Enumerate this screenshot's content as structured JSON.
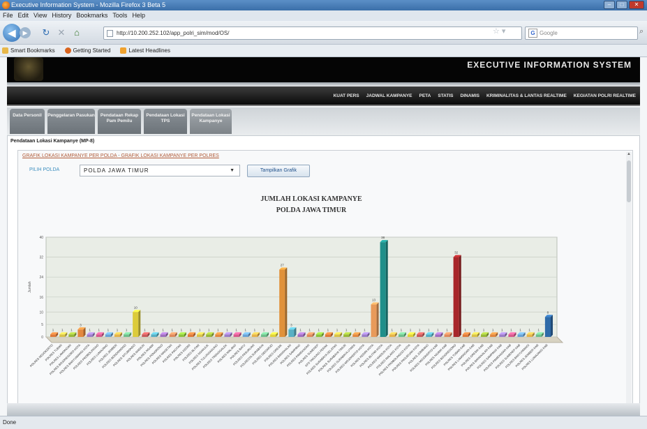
{
  "window": {
    "title": "Executive Information System - Mozilla Firefox 3 Beta 5"
  },
  "menu": [
    "File",
    "Edit",
    "View",
    "History",
    "Bookmarks",
    "Tools",
    "Help"
  ],
  "address": {
    "url": "http://10.200.252.102/app_polri_sim/mod/OS/"
  },
  "search": {
    "placeholder": "Google"
  },
  "bookmarks": [
    "Smart Bookmarks",
    "Getting Started",
    "Latest Headlines"
  ],
  "header": {
    "title": "EXECUTIVE INFORMATION SYSTEM"
  },
  "main_nav": [
    "KUAT PERS",
    "JADWAL KAMPANYE",
    "PETA",
    "STATIS",
    "DINAMIS",
    "KRIMINALITAS & LANTAS REALTIME",
    "KEGIATAN POLRI REALTIME"
  ],
  "tabs": [
    "Data Personil",
    "Penggelaran Pasukan",
    "Pendataan Rekap Pam Pemilu",
    "Pendataan Lokasi TPS",
    "Pendataan Lokasi Kampanye"
  ],
  "section": {
    "title": "Pendataan Lokasi Kampanye (MP-8)"
  },
  "links": {
    "per_polda": "GRAFIK LOKASI KAMPANYE PER POLDA",
    "per_polres": "GRAFIK LOKASI KAMPANYE PER POLRES",
    "separator": "-"
  },
  "filter": {
    "label": "PILIH POLDA",
    "selected": "POLDA JAWA TIMUR",
    "button": "Tampilkan Grafik"
  },
  "status": "Done",
  "chart_data": {
    "type": "bar",
    "title": "JUMLAH LOKASI KAMPANYE",
    "subtitle": "POLDA JAWA TIMUR",
    "ylabel": "Jumlah",
    "ylim": [
      0,
      40
    ],
    "yticks": [
      0,
      5,
      10,
      16,
      24,
      32,
      40
    ],
    "categories": [
      "POLRES MOJOKERTO",
      "POLRES TUBAN",
      "POLRES LAMONGAN",
      "POLRES BOJONEGORO KOTA",
      "POLRES BANYUWANGI KOTA",
      "POLRES PROBOLINGGO",
      "POLRES LUMAJANG",
      "POLRES JEMBER",
      "POLRES BONDOWOSO",
      "POLRES SITUBONDO",
      "POLRES MADIUN",
      "POLRES NGAWI",
      "POLRES PONOROGO",
      "POLRES MAGETAN",
      "POLRES PACITAN",
      "POLRES KEDIRI",
      "POLRES BLITAR",
      "POLRES NGANJUK",
      "POLRES TULUNGAGUNG",
      "POLRES TRENGGALEK",
      "POLRES MALANG",
      "POLRES BATU",
      "POLRES PASURUAN",
      "POLRESTA SURABAYA",
      "POLRES SIDOARJO",
      "POLRES GRESIK",
      "POLRES BANGKALAN",
      "POLRES SAMPANG",
      "POLRES PAMEKASAN",
      "POLRES SUMENEP",
      "KP3 TANJUNG PERAK",
      "POLRES SURABAYA SELATAN",
      "POLRES SURABAYA TIMUR",
      "POLRES SURABAYA UTARA",
      "POLRES MOJOKERTO KOTA",
      "POLRES KEDIRI KOTA",
      "POLRES BLITAR KOTA",
      "POLRES MADIUN KOTA",
      "POLRES MALANG KOTA",
      "POLRES PROBOLINGGO KOTA",
      "POLRES PASURUAN KOTA",
      "POLRES JOMBANG",
      "POLRES MOJOKERTO KAB",
      "POLRES NGAWI KAB",
      "POLRES BOJONEGORO",
      "POLRES TUBAN KAB",
      "POLRES LAMONGAN KAB",
      "POLRES GRESIK KAB",
      "POLRES BANGKALAN KAB",
      "POLRES SAMPANG KAB",
      "POLRES PAMEKASAN KAB",
      "POLRES SUMENEP KAB",
      "POLRES BANYUWANGI",
      "POLRES JEMBER KAB",
      "POLRES LUMAJANG KAB"
    ],
    "values": [
      1,
      1,
      1,
      3,
      1,
      1,
      1,
      1,
      1,
      10,
      1,
      1,
      1,
      1,
      1,
      1,
      1,
      1,
      1,
      1,
      1,
      1,
      1,
      1,
      1,
      27,
      3,
      1,
      1,
      1,
      1,
      1,
      1,
      1,
      1,
      13,
      38,
      1,
      1,
      1,
      1,
      1,
      1,
      1,
      32,
      1,
      1,
      1,
      1,
      1,
      1,
      1,
      1,
      1,
      8
    ],
    "bar_colors": [
      "#e07a3a",
      "#d9c24a",
      "#9ab93a",
      "#e3883f",
      "#9c7ec9",
      "#d85a8e",
      "#6aa3d6",
      "#e6b34a",
      "#6fbf8c",
      "#e0d23b",
      "#c95b5b",
      "#58b0c4",
      "#a06fc0",
      "#e08a5c",
      "#8cc43e"
    ]
  }
}
